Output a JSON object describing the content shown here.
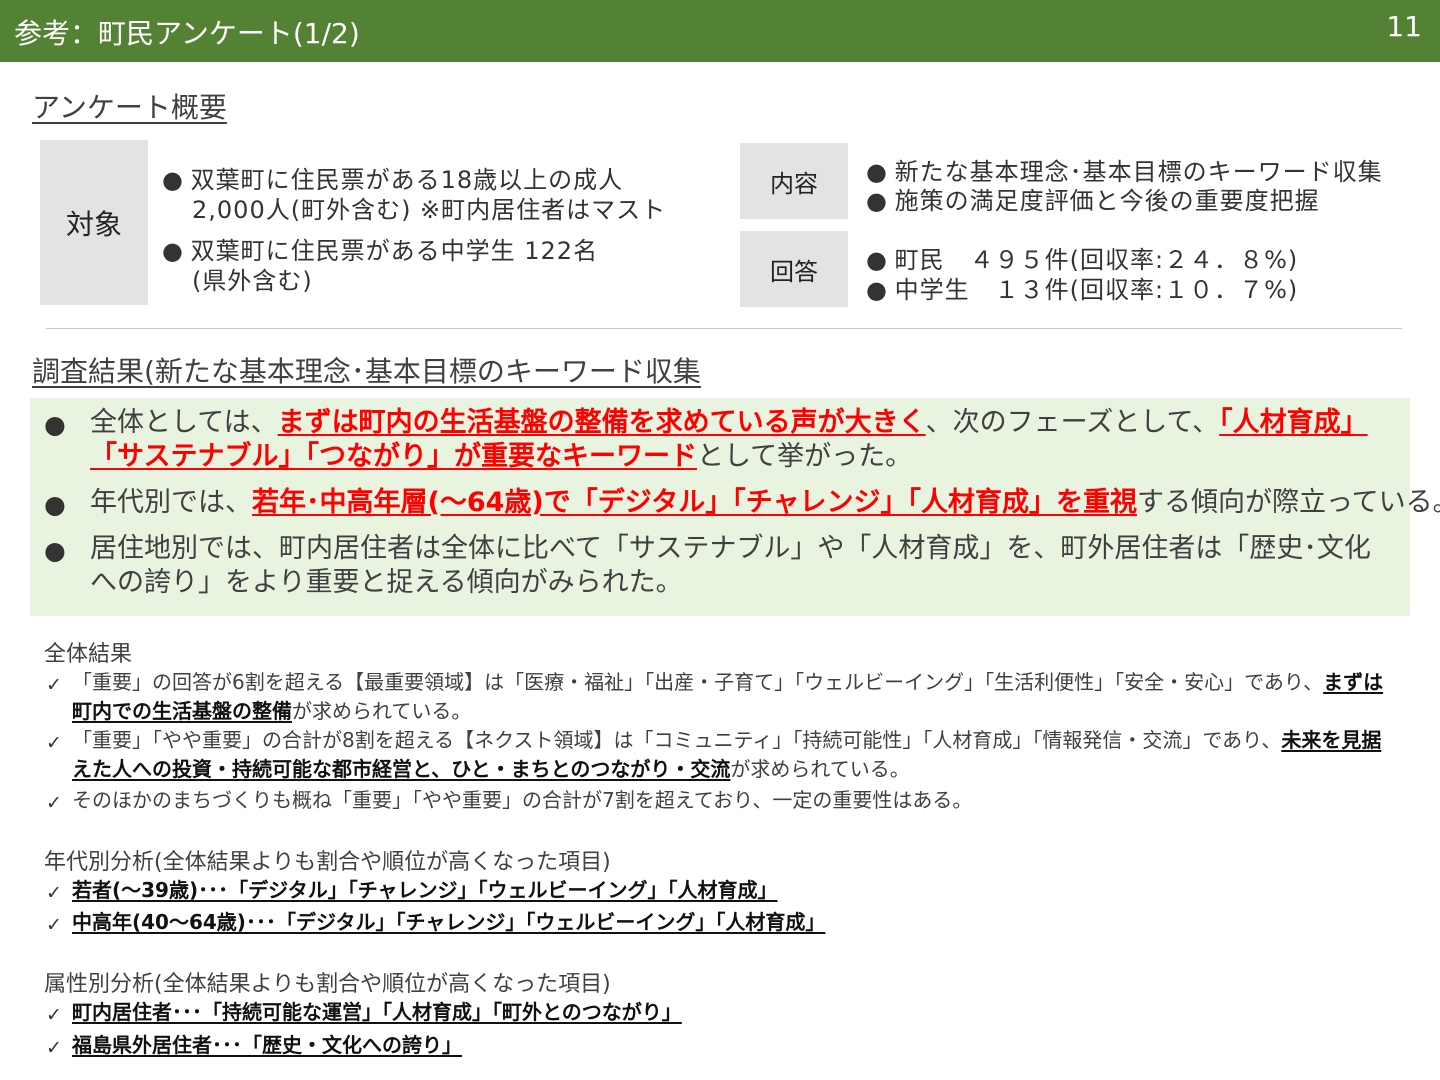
{
  "header": {
    "title": "参考：町民アンケート(1/2)",
    "page_number": "11"
  },
  "overview": {
    "title": "アンケート概要",
    "target_label": "対象",
    "target_items": [
      {
        "line1": "双葉町に住民票がある18歳以上の成人",
        "line2": "2,000人(町外含む) ※町内居住者はマスト"
      },
      {
        "line1": "双葉町に住民票がある中学生 122名",
        "line2": "(県外含む)"
      }
    ],
    "content_label": "内容",
    "content_items": [
      "新たな基本理念･基本目標のキーワード収集",
      "施策の満足度評価と今後の重要度把握"
    ],
    "answer_label": "回答",
    "answer_items": [
      "町民　４９５件(回収率:２４．８%)",
      "中学生　１３件(回収率:１０．７%)"
    ]
  },
  "results": {
    "title": "調査結果(新たな基本理念･基本目標のキーワード収集",
    "bullet1": {
      "pre": "全体としては、",
      "hl1": "まずは町内の生活基盤の整備を求めている声が大きく",
      "mid": "、次のフェーズとして、",
      "hl2": "「人材育成」「サステナブル」「つながり」が重要なキーワード",
      "post": "として挙がった。"
    },
    "bullet2": {
      "pre": "年代別では、",
      "hl": "若年･中高年層(～64歳)で「デジタル」「チャレンジ」「人材育成」を重視",
      "post": "する傾向が際立っている。"
    },
    "bullet3": {
      "text": "居住地別では、町内居住者は全体に比べて「サステナブル」や「人材育成」を、町外居住者は「歴史･文化への誇り」をより重要と捉える傾向がみられた。"
    }
  },
  "overall": {
    "title": "全体結果",
    "item1": {
      "pre": "「重要」の回答が6割を超える【最重要領域】は「医療・福祉」「出産・子育て」「ウェルビーイング」「生活利便性」「安全・安心」であり、",
      "bold": "まずは町内での生活基盤の整備",
      "post": "が求められている。"
    },
    "item2": {
      "pre": "「重要」「やや重要」の合計が8割を超える【ネクスト領域】は「コミュニティ」「持続可能性」「人材育成」「情報発信・交流」であり、",
      "bold": "未来を見据えた人への投資・持続可能な都市経営と、ひと・まちとのつながり・交流",
      "post": "が求められている。"
    },
    "item3": "そのほかのまちづくりも概ね「重要」「やや重要」の合計が7割を超えており、一定の重要性はある。"
  },
  "age_analysis": {
    "title": "年代別分析(全体結果よりも割合や順位が高くなった項目)",
    "items": [
      "若者(～39歳)･･･「デジタル」「チャレンジ」「ウェルビーイング」「人材育成」",
      "中高年(40～64歳)･･･「デジタル」「チャレンジ」「ウェルビーイング」「人材育成」"
    ]
  },
  "attribute_analysis": {
    "title": "属性別分析(全体結果よりも割合や順位が高くなった項目)",
    "items": [
      "町内居住者･･･「持続可能な運営」「人材育成」「町外とのつながり」",
      "福島県外居住者･･･「歴史・文化への誇り」"
    ]
  },
  "icons": {
    "bullet": "●",
    "check": "✓"
  },
  "colors": {
    "header_bg": "#548235",
    "highlight_red": "#ff0000",
    "summary_bg": "#e8f3e0",
    "label_box": "#e3e3e3"
  }
}
